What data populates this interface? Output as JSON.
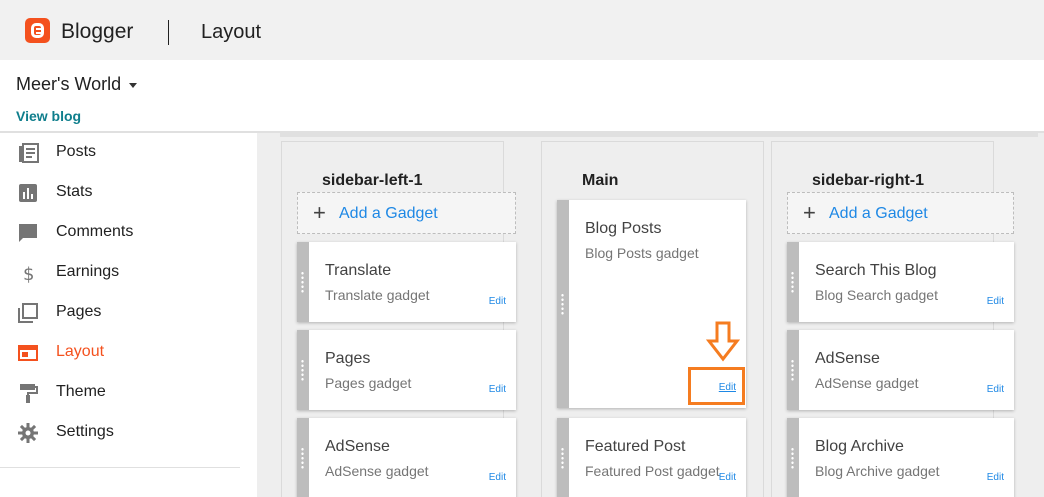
{
  "app": {
    "name": "Blogger",
    "page": "Layout"
  },
  "blog": {
    "name": "Meer's World",
    "view_link": "View blog"
  },
  "sidebar": {
    "items": [
      {
        "label": "Posts",
        "icon": "posts-icon"
      },
      {
        "label": "Stats",
        "icon": "stats-icon"
      },
      {
        "label": "Comments",
        "icon": "comments-icon"
      },
      {
        "label": "Earnings",
        "icon": "dollar-icon"
      },
      {
        "label": "Pages",
        "icon": "pages-icon"
      },
      {
        "label": "Layout",
        "icon": "layout-icon",
        "active": true
      },
      {
        "label": "Theme",
        "icon": "paint-roller-icon"
      },
      {
        "label": "Settings",
        "icon": "gear-icon"
      }
    ]
  },
  "columns": {
    "left": {
      "title": "sidebar-left-1",
      "add_label": "Add a Gadget",
      "gadgets": [
        {
          "title": "Translate",
          "subtitle": "Translate gadget",
          "edit": "Edit"
        },
        {
          "title": "Pages",
          "subtitle": "Pages gadget",
          "edit": "Edit"
        },
        {
          "title": "AdSense",
          "subtitle": "AdSense gadget",
          "edit": "Edit"
        }
      ]
    },
    "main": {
      "title": "Main",
      "gadgets": [
        {
          "title": "Blog Posts",
          "subtitle": "Blog Posts gadget",
          "edit": "Edit"
        },
        {
          "title": "Featured Post",
          "subtitle": "Featured Post gadget",
          "edit": "Edit"
        }
      ]
    },
    "right": {
      "title": "sidebar-right-1",
      "add_label": "Add a Gadget",
      "gadgets": [
        {
          "title": "Search This Blog",
          "subtitle": "Blog Search gadget",
          "edit": "Edit"
        },
        {
          "title": "AdSense",
          "subtitle": "AdSense gadget",
          "edit": "Edit"
        },
        {
          "title": "Blog Archive",
          "subtitle": "Blog Archive gadget",
          "edit": "Edit"
        }
      ]
    }
  },
  "colors": {
    "accent": "#f4511e",
    "link": "#1e88e5",
    "view_blog": "#0f7e8c",
    "annotation": "#f57c20"
  }
}
